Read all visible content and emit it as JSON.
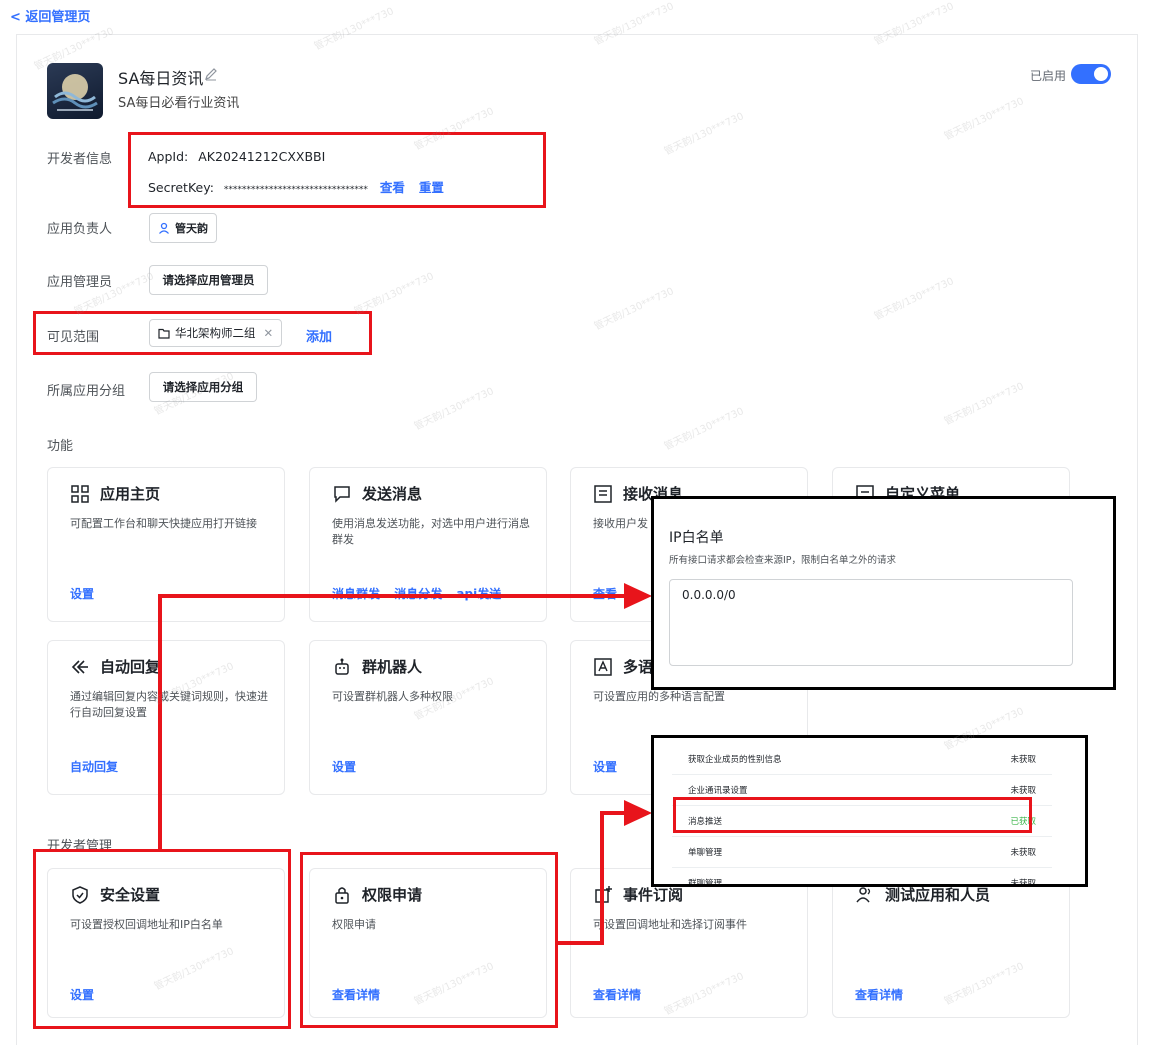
{
  "nav": {
    "back_label": "< 返回管理页"
  },
  "app": {
    "name": "SA每日资讯",
    "description": "SA每日必看行业资讯",
    "status_label": "已启用",
    "enabled": true
  },
  "developer_info": {
    "label": "开发者信息",
    "app_id_label": "AppId:",
    "app_id": "AK20241212CXXBBI",
    "secret_label": "SecretKey:",
    "secret_value": "********************************",
    "view_link": "查看",
    "reset_link": "重置"
  },
  "owner": {
    "label": "应用负责人",
    "value": "管天韵"
  },
  "admins": {
    "label": "应用管理员",
    "button": "请选择应用管理员"
  },
  "visibility": {
    "label": "可见范围",
    "tag": "华北架构师二组",
    "add_link": "添加"
  },
  "group": {
    "label": "所属应用分组",
    "button": "请选择应用分组"
  },
  "functions": {
    "title": "功能",
    "cards": [
      {
        "title": "应用主页",
        "desc": "可配置工作台和聊天快捷应用打开链接",
        "links": [
          "设置"
        ]
      },
      {
        "title": "发送消息",
        "desc": "使用消息发送功能，对选中用户进行消息群发",
        "links": [
          "消息群发",
          "消息分发",
          "api发送"
        ]
      },
      {
        "title": "接收消息",
        "desc": "接收用户发",
        "links": [
          "查看"
        ]
      },
      {
        "title": "自定义菜单",
        "desc": "",
        "links": []
      },
      {
        "title": "自动回复",
        "desc": "通过编辑回复内容或关键词规则，快速进行自动回复设置",
        "links": [
          "自动回复"
        ]
      },
      {
        "title": "群机器人",
        "desc": "可设置群机器人多种权限",
        "links": [
          "设置"
        ]
      },
      {
        "title": "多语",
        "desc": "可设置应用的多种语言配置",
        "links": [
          "设置"
        ]
      }
    ]
  },
  "dev_management": {
    "title": "开发者管理",
    "cards": [
      {
        "title": "安全设置",
        "desc": "可设置授权回调地址和IP白名单",
        "links": [
          "设置"
        ]
      },
      {
        "title": "权限申请",
        "desc": "权限申请",
        "links": [
          "查看详情"
        ]
      },
      {
        "title": "事件订阅",
        "desc": "可设置回调地址和选择订阅事件",
        "links": [
          "查看详情"
        ]
      },
      {
        "title": "测试应用和人员",
        "desc": "",
        "links": [
          "查看详情"
        ]
      }
    ]
  },
  "ip_popup": {
    "title": "IP白名单",
    "desc": "所有接口请求都会检查来源IP，限制白名单之外的请求",
    "value": "0.0.0.0/0"
  },
  "perm_popup": {
    "rows": [
      {
        "name": "获取企业成员的性别信息",
        "status": "未获取"
      },
      {
        "name": "企业通讯录设置",
        "status": "未获取"
      },
      {
        "name": "消息推送",
        "status": "已获取"
      },
      {
        "name": "单聊管理",
        "status": "未获取"
      },
      {
        "name": "群聊管理",
        "status": "未获取"
      }
    ]
  },
  "watermark": "管天韵/130***730",
  "colors": {
    "accent": "#3370ff",
    "annotation": "#e8141b",
    "granted": "#3bb54a"
  }
}
